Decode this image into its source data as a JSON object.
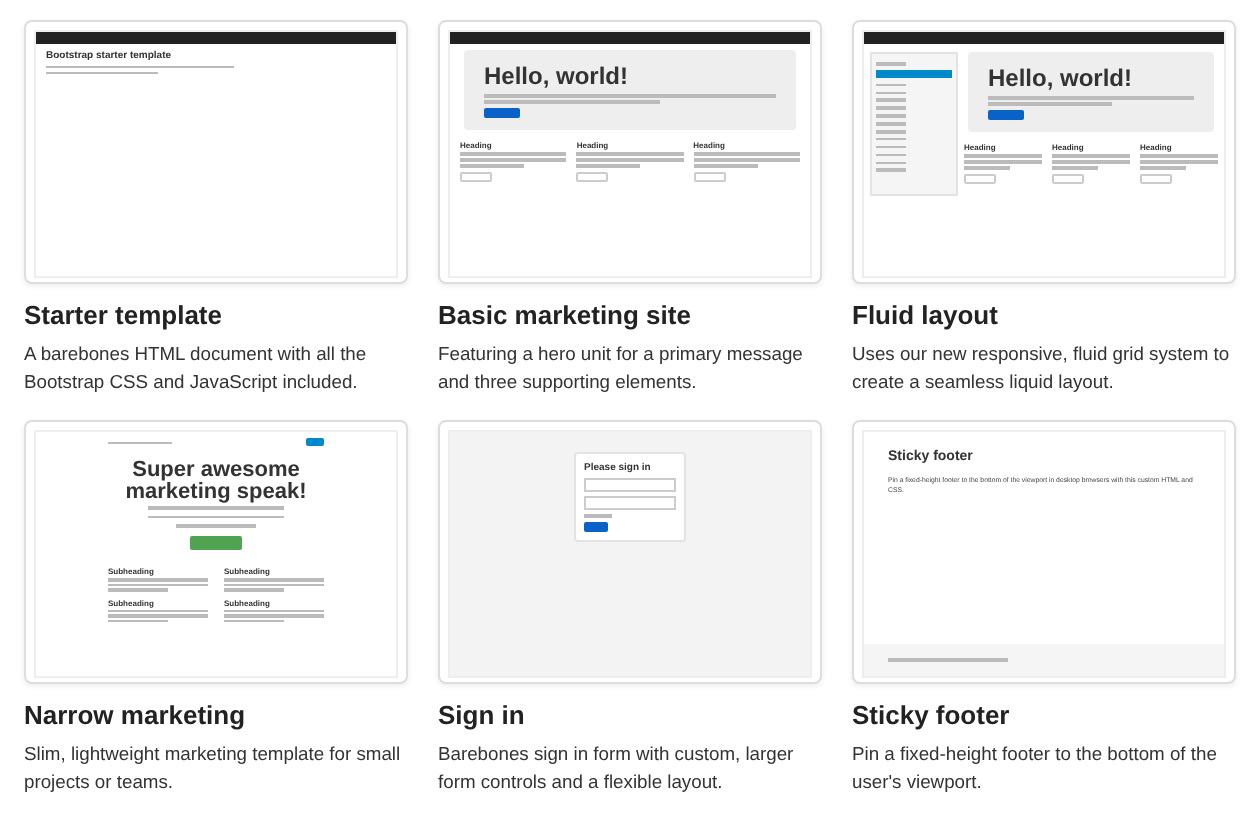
{
  "examples": [
    {
      "title": "Starter template",
      "description": "A barebones HTML document with all the Bootstrap CSS and JavaScript included.",
      "thumbnail": {
        "kind": "starter",
        "heading": "Bootstrap starter template"
      }
    },
    {
      "title": "Basic marketing site",
      "description": "Featuring a hero unit for a primary message and three supporting elements.",
      "thumbnail": {
        "kind": "marketing",
        "heading": "Hello, world!",
        "columns": [
          "Heading",
          "Heading",
          "Heading"
        ]
      }
    },
    {
      "title": "Fluid layout",
      "description": "Uses our new responsive, fluid grid system to create a seamless liquid layout.",
      "thumbnail": {
        "kind": "fluid",
        "heading": "Hello, world!",
        "columns": [
          "Heading",
          "Heading",
          "Heading"
        ]
      }
    },
    {
      "title": "Narrow marketing",
      "description": "Slim, lightweight marketing template for small projects or teams.",
      "thumbnail": {
        "kind": "narrow",
        "heading": "Super awesome marketing speak!",
        "columns": [
          "Subheading",
          "Subheading",
          "Subheading",
          "Subheading"
        ]
      }
    },
    {
      "title": "Sign in",
      "description": "Barebones sign in form with custom, larger form controls and a flexible layout.",
      "thumbnail": {
        "kind": "signin",
        "heading": "Please sign in"
      }
    },
    {
      "title": "Sticky footer",
      "description": "Pin a fixed-height footer to the bottom of the user's viewport.",
      "thumbnail": {
        "kind": "sticky",
        "heading": "Sticky footer",
        "text": "Pin a fixed-height footer to the bottom of the viewport in desktop browsers with this custom HTML and CSS."
      }
    }
  ]
}
